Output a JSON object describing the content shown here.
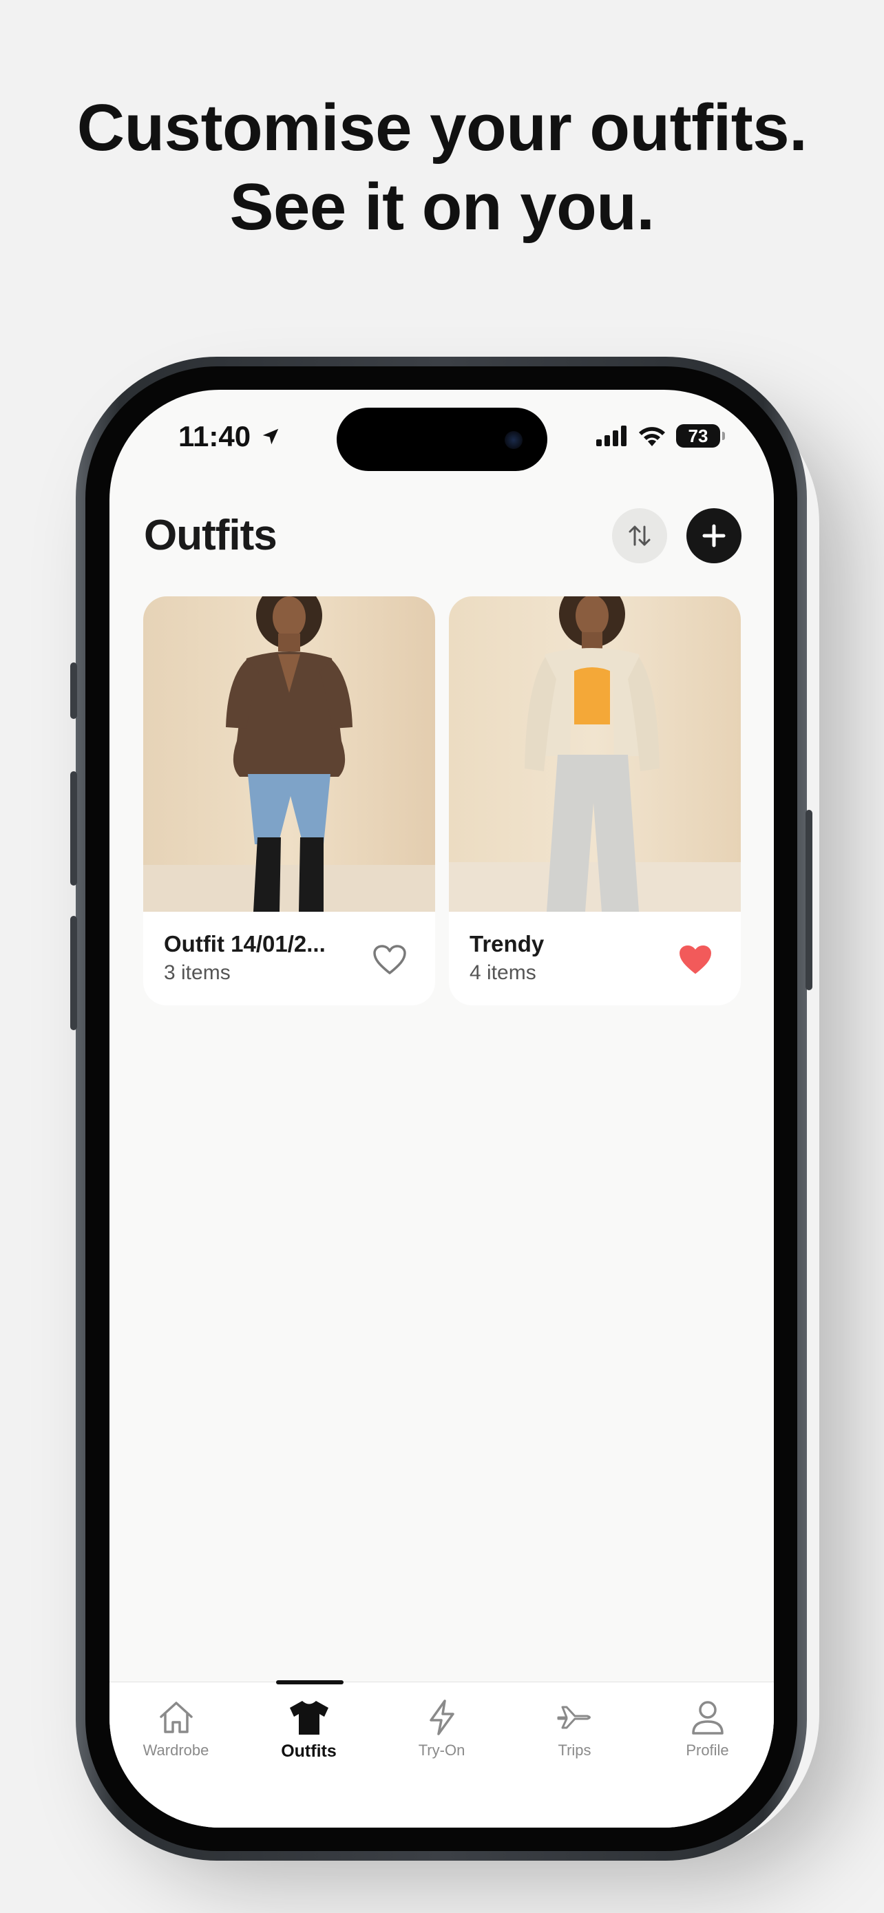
{
  "headline": {
    "line1": "Customise your outfits.",
    "line2": "See it on you."
  },
  "status_bar": {
    "time": "11:40",
    "battery": "73",
    "icons": [
      "location-arrow-icon",
      "cellular-signal-icon",
      "wifi-icon",
      "battery-icon"
    ]
  },
  "header": {
    "title": "Outfits",
    "sort_icon": "sort-arrows-icon",
    "add_icon": "plus-icon"
  },
  "outfits": [
    {
      "title": "Outfit 14/01/2...",
      "count": "3 items",
      "favorite": false
    },
    {
      "title": "Trendy",
      "count": "4 items",
      "favorite": true
    }
  ],
  "tabs": [
    {
      "label": "Wardrobe",
      "icon": "home-icon",
      "active": false
    },
    {
      "label": "Outfits",
      "icon": "tshirt-icon",
      "active": true
    },
    {
      "label": "Try-On",
      "icon": "lightning-icon",
      "active": false
    },
    {
      "label": "Trips",
      "icon": "airplane-icon",
      "active": false
    },
    {
      "label": "Profile",
      "icon": "person-icon",
      "active": false
    }
  ],
  "colors": {
    "background": "#f2f2f2",
    "screen": "#f9f9f8",
    "accent_dark": "#161616",
    "favorite_red": "#f25a5a",
    "photo_backdrop": "#ead9c0"
  }
}
